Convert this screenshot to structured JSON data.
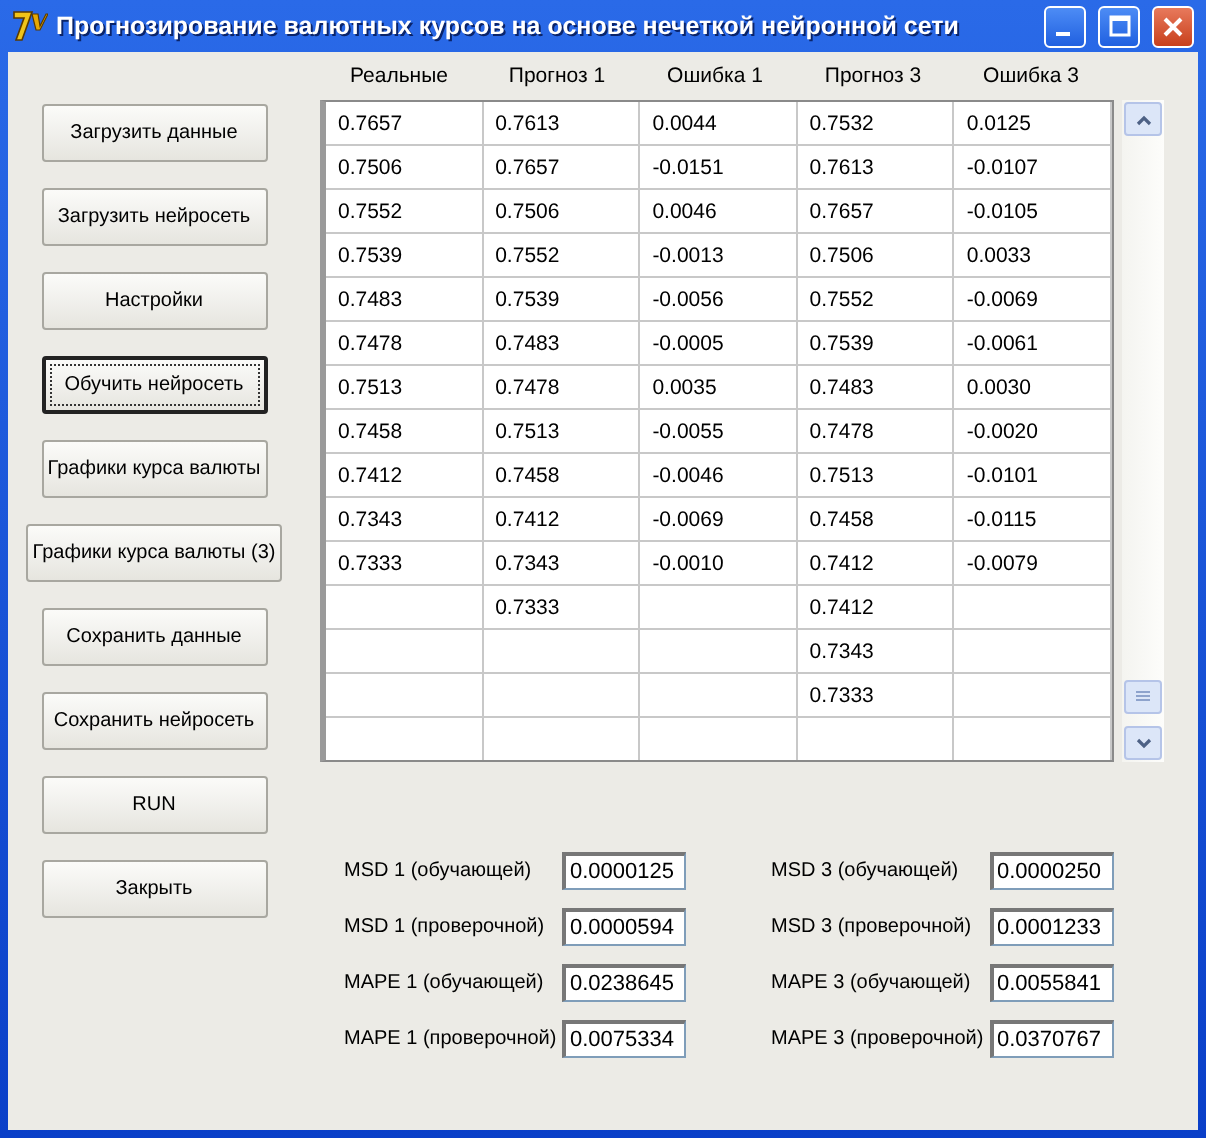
{
  "window": {
    "title": "Прогнозирование валютных курсов на основе нечеткой нейронной сети"
  },
  "buttons": [
    {
      "label": "Загрузить данные",
      "focused": false,
      "wide": false
    },
    {
      "label": "Загрузить нейросеть",
      "focused": false,
      "wide": false
    },
    {
      "label": "Настройки",
      "focused": false,
      "wide": false
    },
    {
      "label": "Обучить нейросеть",
      "focused": true,
      "wide": false
    },
    {
      "label": "Графики курса валюты",
      "focused": false,
      "wide": false
    },
    {
      "label": "Графики курса валюты (3)",
      "focused": false,
      "wide": true
    },
    {
      "label": "Сохранить данные",
      "focused": false,
      "wide": false
    },
    {
      "label": "Сохранить нейросеть",
      "focused": false,
      "wide": false
    },
    {
      "label": "RUN",
      "focused": false,
      "wide": false
    },
    {
      "label": "Закрыть",
      "focused": false,
      "wide": false
    }
  ],
  "table": {
    "columns": [
      "Реальные",
      "Прогноз 1",
      "Ошибка 1",
      "Прогноз 3",
      "Ошибка 3"
    ],
    "rows": [
      [
        "0.7657",
        "0.7613",
        "0.0044",
        "0.7532",
        "0.0125"
      ],
      [
        "0.7506",
        "0.7657",
        "-0.0151",
        "0.7613",
        "-0.0107"
      ],
      [
        "0.7552",
        "0.7506",
        "0.0046",
        "0.7657",
        "-0.0105"
      ],
      [
        "0.7539",
        "0.7552",
        "-0.0013",
        "0.7506",
        "0.0033"
      ],
      [
        "0.7483",
        "0.7539",
        "-0.0056",
        "0.7552",
        "-0.0069"
      ],
      [
        "0.7478",
        "0.7483",
        "-0.0005",
        "0.7539",
        "-0.0061"
      ],
      [
        "0.7513",
        "0.7478",
        "0.0035",
        "0.7483",
        "0.0030"
      ],
      [
        "0.7458",
        "0.7513",
        "-0.0055",
        "0.7478",
        "-0.0020"
      ],
      [
        "0.7412",
        "0.7458",
        "-0.0046",
        "0.7513",
        "-0.0101"
      ],
      [
        "0.7343",
        "0.7412",
        "-0.0069",
        "0.7458",
        "-0.0115"
      ],
      [
        "0.7333",
        "0.7343",
        "-0.0010",
        "0.7412",
        "-0.0079"
      ],
      [
        null,
        "0.7333",
        null,
        "0.7412",
        null
      ],
      [
        null,
        null,
        null,
        "0.7343",
        null
      ],
      [
        null,
        null,
        null,
        "0.7333",
        null
      ],
      [
        null,
        null,
        null,
        null,
        null
      ]
    ]
  },
  "metrics": [
    [
      {
        "label": "MSD 1 (обучающей)",
        "value": "0.0000125"
      },
      {
        "label": "MSD 3 (обучающей)",
        "value": "0.0000250"
      }
    ],
    [
      {
        "label": "MSD 1 (проверочной)",
        "value": "0.0000594"
      },
      {
        "label": "MSD 3 (проверочной)",
        "value": "0.0001233"
      }
    ],
    [
      {
        "label": "MAPE 1 (обучающей)",
        "value": "0.0238645"
      },
      {
        "label": "MAPE 3 (обучающей)",
        "value": "0.0055841"
      }
    ],
    [
      {
        "label": "MAPE 1 (проверочной)",
        "value": "0.0075334"
      },
      {
        "label": "MAPE 3 (проверочной)",
        "value": "0.0370767"
      }
    ]
  ]
}
